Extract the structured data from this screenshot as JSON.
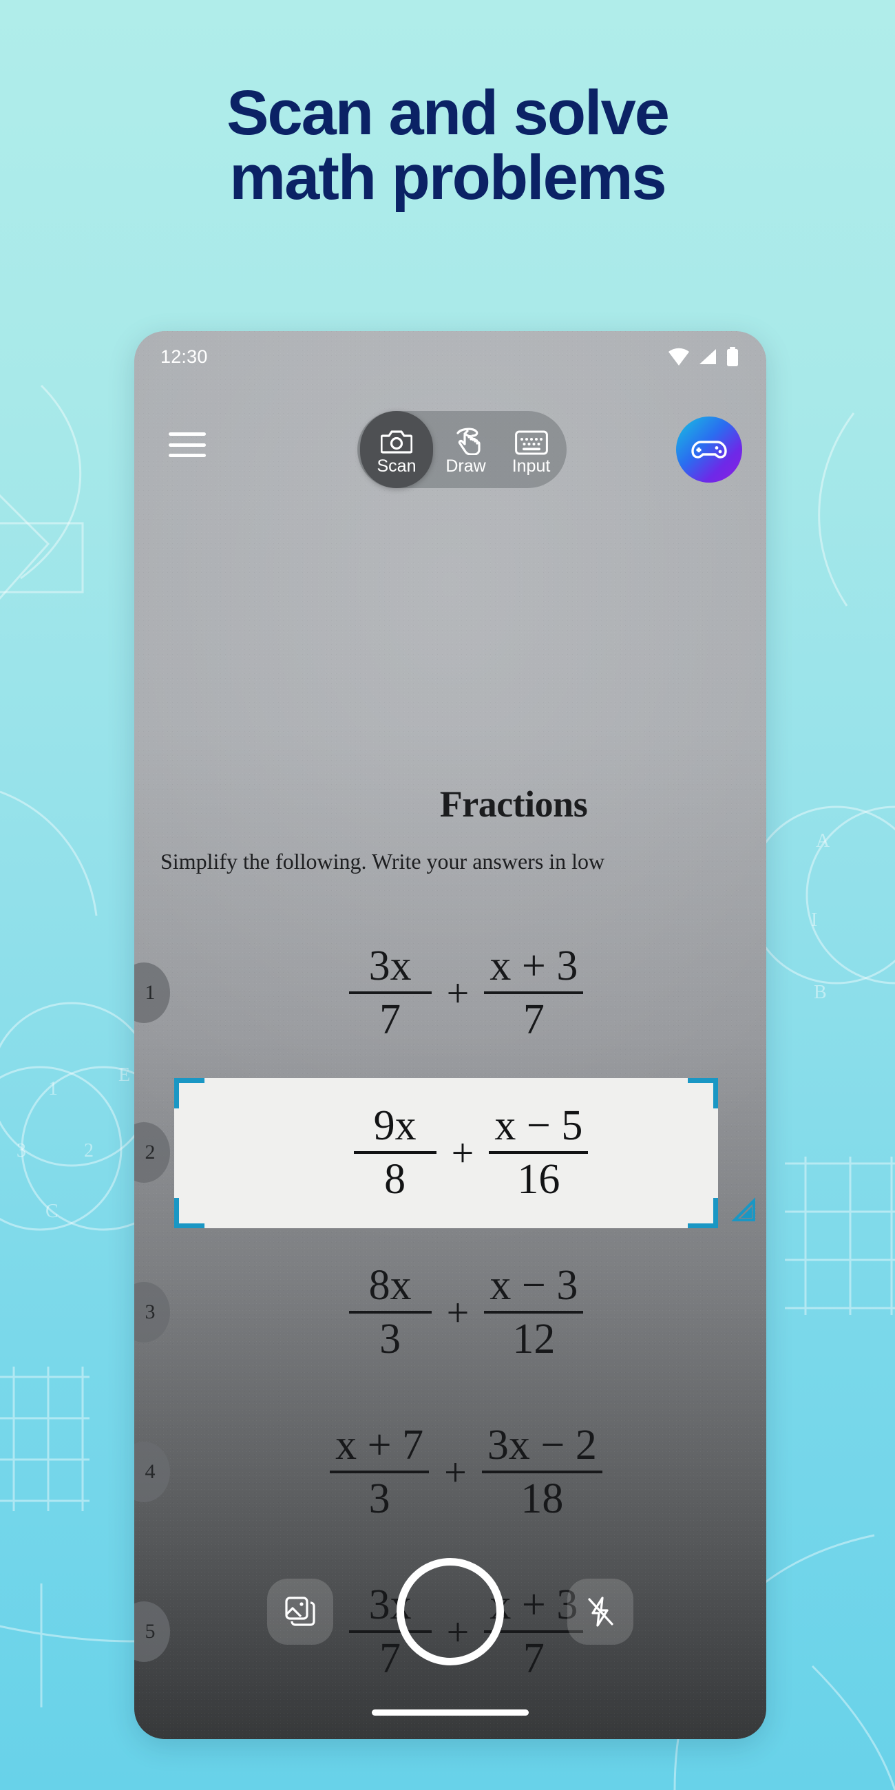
{
  "theme": {
    "bg_top": "#B0EDEA",
    "bg_bottom": "#68D2E9",
    "headline_color": "#0B2265",
    "scan_bracket_color": "#1A97C4",
    "avatar_gradient": "#17C3E0 -> #8B1FE0"
  },
  "headline": {
    "line1": "Scan and solve",
    "line2": "math problems"
  },
  "phone": {
    "status_bar": {
      "time": "12:30",
      "icons": [
        "wifi-icon",
        "cellular-signal-icon",
        "battery-icon"
      ]
    },
    "toolbar": {
      "menu_icon": "hamburger-menu-icon",
      "modes": [
        {
          "label": "Scan",
          "icon": "camera-icon",
          "active": true
        },
        {
          "label": "Draw",
          "icon": "hand-draw-icon",
          "active": false
        },
        {
          "label": "Input",
          "icon": "keyboard-icon",
          "active": false
        }
      ],
      "avatar_icon": "gamepad-icon"
    },
    "worksheet": {
      "title": "Fractions",
      "instruction": "Simplify the following. Write your answers in low",
      "problems": [
        {
          "number": "1",
          "selected": false,
          "left": {
            "num": "3x",
            "den": "7"
          },
          "op": "+",
          "right": {
            "num": "x + 3",
            "den": "7"
          }
        },
        {
          "number": "2",
          "selected": true,
          "left": {
            "num": "9x",
            "den": "8"
          },
          "op": "+",
          "right": {
            "num": "x − 5",
            "den": "16"
          }
        },
        {
          "number": "3",
          "selected": false,
          "left": {
            "num": "8x",
            "den": "3"
          },
          "op": "+",
          "right": {
            "num": "x − 3",
            "den": "12"
          }
        },
        {
          "number": "4",
          "selected": false,
          "left": {
            "num": "x + 7",
            "den": "3"
          },
          "op": "+",
          "right": {
            "num": "3x − 2",
            "den": "18"
          }
        },
        {
          "number": "5",
          "selected": false,
          "left": {
            "num": "3x",
            "den": "7"
          },
          "op": "+",
          "right": {
            "num": "x + 3",
            "den": "7"
          }
        }
      ]
    },
    "camera_controls": {
      "gallery_icon": "gallery-icon",
      "shutter_icon": "shutter-button",
      "flash_icon": "flash-off-icon"
    }
  }
}
